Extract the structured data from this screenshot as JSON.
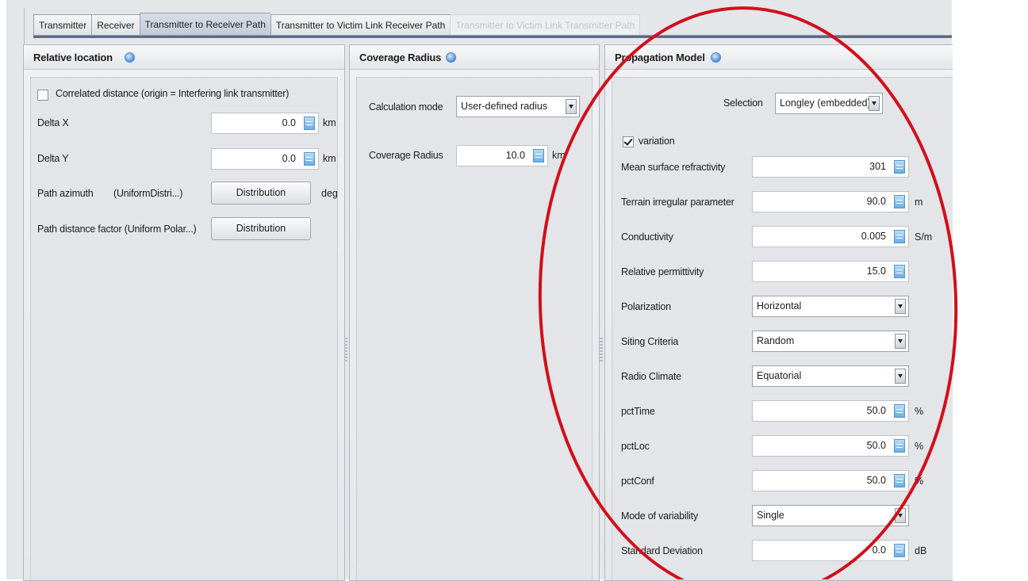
{
  "tabs": [
    {
      "label": "Transmitter",
      "state": "normal"
    },
    {
      "label": "Receiver",
      "state": "normal"
    },
    {
      "label": "Transmitter to Receiver Path",
      "state": "selected"
    },
    {
      "label": "Transmitter to Victim Link Receiver Path",
      "state": "normal"
    },
    {
      "label": "Transmitter to Victim Link Transmitter Path",
      "state": "disabled"
    }
  ],
  "relative_location": {
    "title": "Relative location",
    "correlated_checkbox": {
      "label": "Correlated distance (origin = Interfering link transmitter)",
      "checked": false
    },
    "delta_x": {
      "label": "Delta X",
      "value": "0.0",
      "unit": "km"
    },
    "delta_y": {
      "label": "Delta Y",
      "value": "0.0",
      "unit": "km"
    },
    "path_azimuth": {
      "label": "Path azimuth",
      "dist": "(UniformDistri...)",
      "button": "Distribution",
      "unit": "deg"
    },
    "path_distance": {
      "label": "Path distance factor (Uniform Polar...)",
      "button": "Distribution"
    }
  },
  "coverage_radius": {
    "title": "Coverage Radius",
    "calc_mode": {
      "label": "Calculation mode",
      "value": "User-defined radius"
    },
    "radius": {
      "label": "Coverage Radius",
      "value": "10.0",
      "unit": "km"
    }
  },
  "propagation_model": {
    "title": "Propagation Model",
    "selection": {
      "label": "Selection",
      "value": "Longley (embedded)"
    },
    "variation": {
      "label": "variation",
      "checked": true
    },
    "fields": [
      {
        "key": "refractivity",
        "label": "Mean surface refractivity",
        "type": "spinner",
        "value": "301",
        "unit": ""
      },
      {
        "key": "terrain",
        "label": "Terrain irregular parameter",
        "type": "spinner",
        "value": "90.0",
        "unit": "m"
      },
      {
        "key": "conductivity",
        "label": "Conductivity",
        "type": "spinner",
        "value": "0.005",
        "unit": "S/m"
      },
      {
        "key": "permittivity",
        "label": "Relative permittivity",
        "type": "spinner",
        "value": "15.0",
        "unit": ""
      },
      {
        "key": "polarization",
        "label": "Polarization",
        "type": "combo",
        "value": "Horizontal",
        "unit": ""
      },
      {
        "key": "siting",
        "label": "Siting Criteria",
        "type": "combo",
        "value": "Random",
        "unit": ""
      },
      {
        "key": "climate",
        "label": "Radio Climate",
        "type": "combo",
        "value": "Equatorial",
        "unit": ""
      },
      {
        "key": "pcttime",
        "label": "pctTime",
        "type": "spinner",
        "value": "50.0",
        "unit": "%"
      },
      {
        "key": "pctloc",
        "label": "pctLoc",
        "type": "spinner",
        "value": "50.0",
        "unit": "%"
      },
      {
        "key": "pctconf",
        "label": "pctConf",
        "type": "spinner",
        "value": "50.0",
        "unit": "%"
      },
      {
        "key": "variability",
        "label": "Mode of variability",
        "type": "combo",
        "value": "Single",
        "unit": ""
      },
      {
        "key": "stddev",
        "label": "Standard Deviation",
        "type": "spinner",
        "value": "0.0",
        "unit": "dB"
      }
    ]
  },
  "annotation": {
    "color": "#d0101c",
    "shape": "ellipse"
  }
}
